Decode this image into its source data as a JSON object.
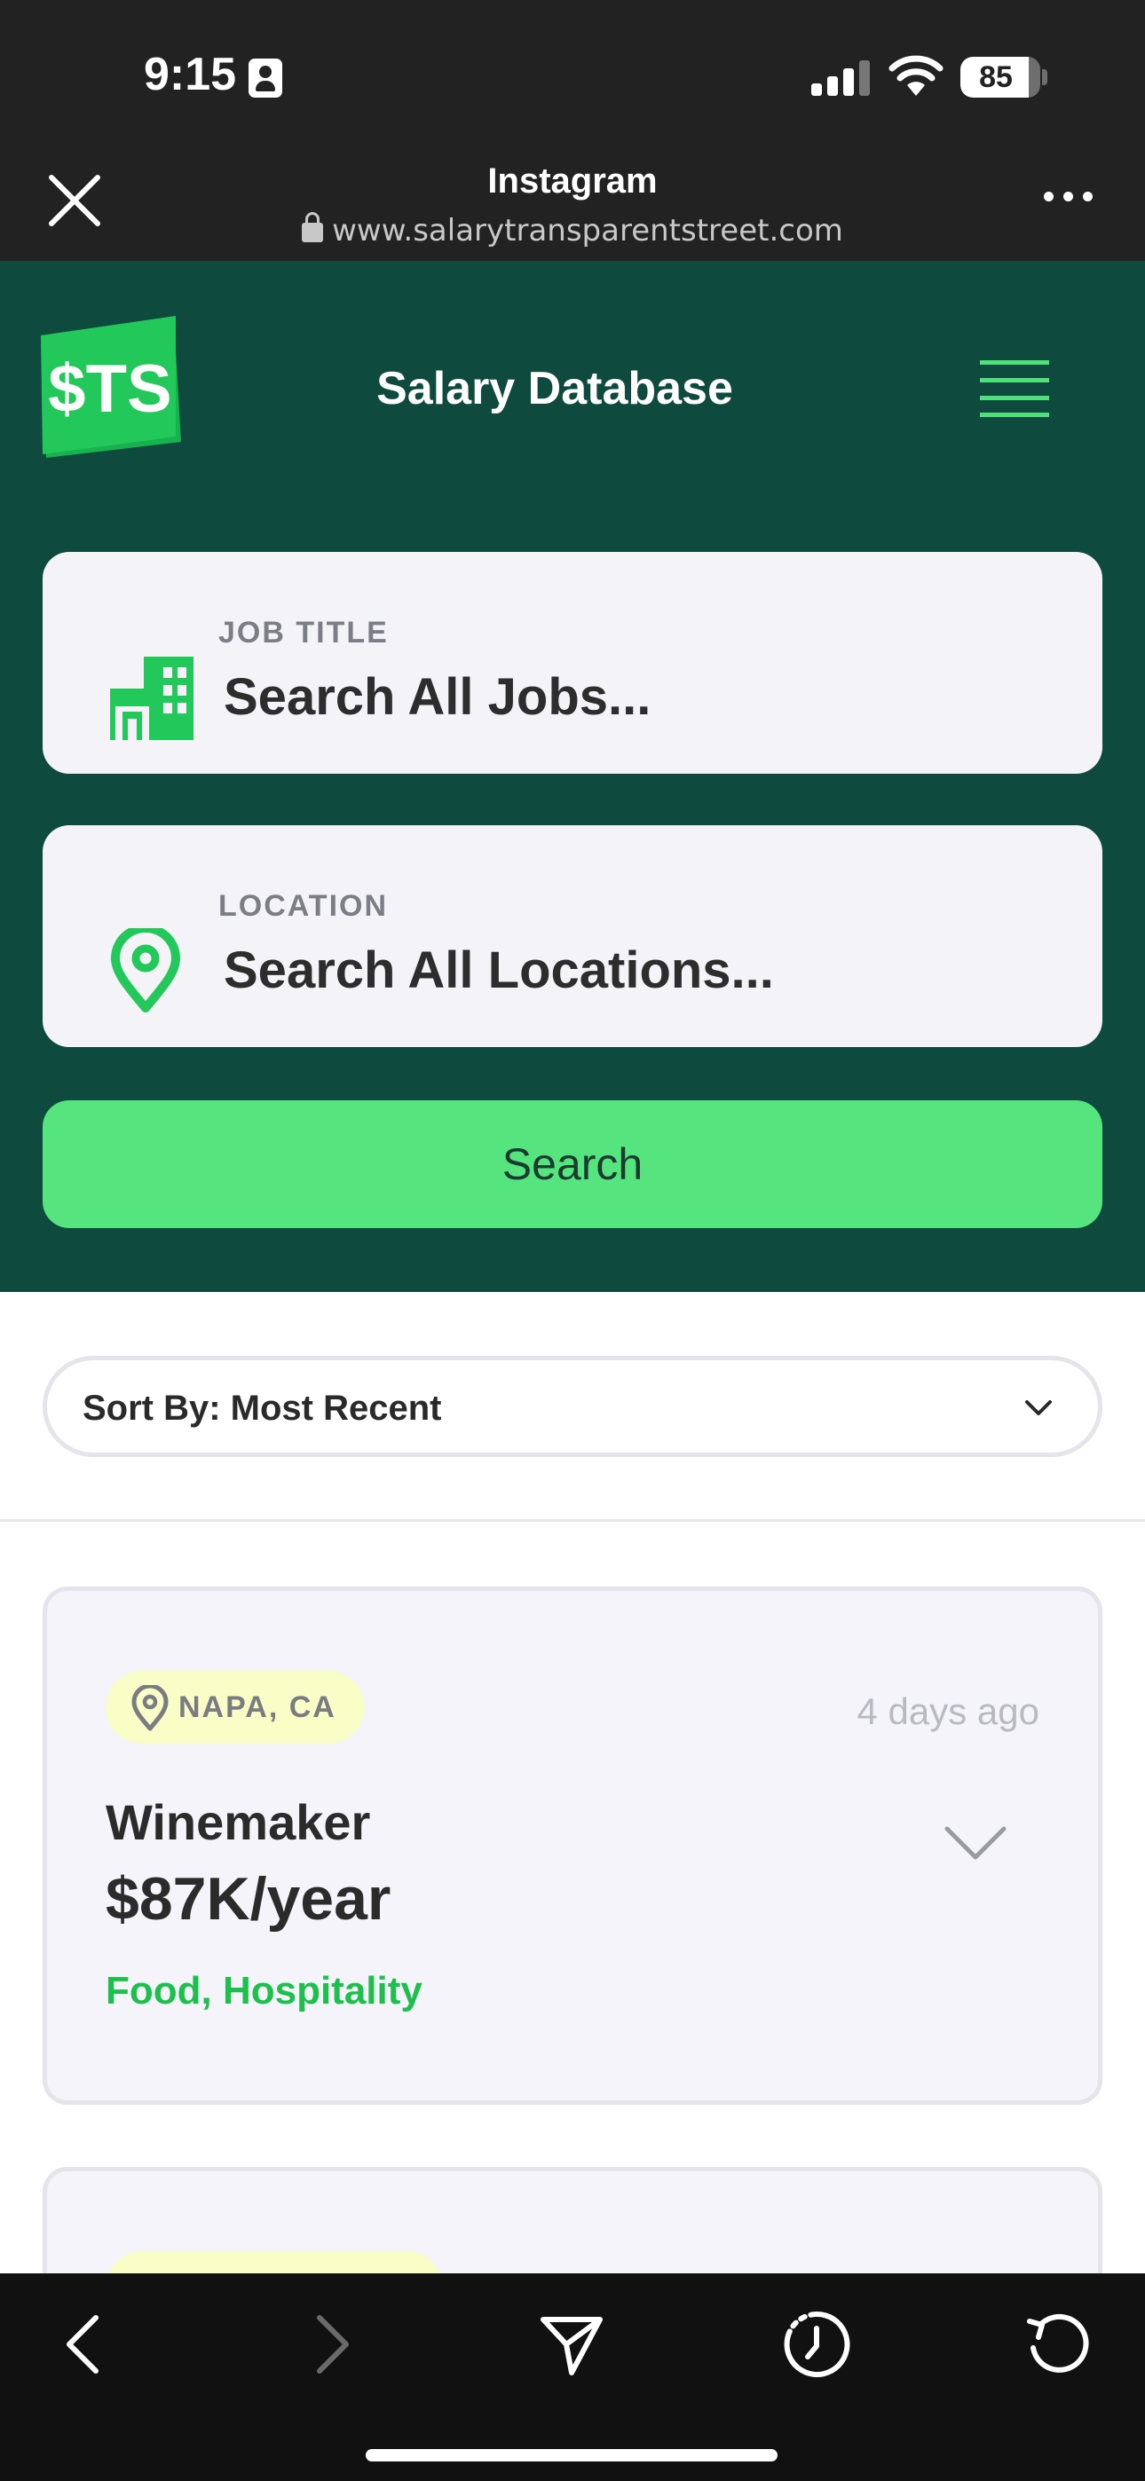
{
  "status_bar": {
    "time": "9:15",
    "battery_level": "85",
    "icons": [
      "person-card-icon",
      "cellular-signal-icon",
      "wifi-icon",
      "battery-icon"
    ]
  },
  "browser": {
    "title": "Instagram",
    "url": "www.salarytransparentstreet.com",
    "icons": [
      "close-icon",
      "lock-icon",
      "more-icon"
    ]
  },
  "header": {
    "logo_text": "$TS",
    "title": "Salary Database",
    "menu_icon": "hamburger-menu-icon"
  },
  "search": {
    "job_label": "JOB TITLE",
    "job_placeholder": "Search All Jobs...",
    "location_label": "LOCATION",
    "location_placeholder": "Search All Locations...",
    "button_label": "Search"
  },
  "sort": {
    "label": "Sort By: Most Recent"
  },
  "results": [
    {
      "location": "NAPA, CA",
      "posted": "4 days ago",
      "title": "Winemaker",
      "salary": "$87K/year",
      "category": "Food, Hospitality"
    }
  ],
  "toolbar": {
    "icons": [
      "back-icon",
      "forward-icon",
      "share-icon",
      "history-icon",
      "reload-icon"
    ]
  },
  "colors": {
    "brand_dark": "#0e4a3e",
    "brand_green": "#55e47e",
    "tag_bg": "#f9fdc6",
    "category_text": "#1fbf4e"
  }
}
